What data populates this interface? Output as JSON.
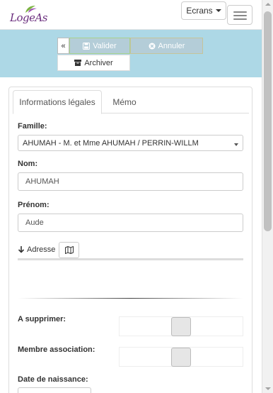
{
  "navbar": {
    "logo_text": "LogeAs",
    "ecrans_label": "Ecrans"
  },
  "toolbar": {
    "collapse_label": "«",
    "valider_label": "Valider",
    "annuler_label": "Annuler",
    "archiver_label": "Archiver"
  },
  "tabs": [
    {
      "label": "Informations légales",
      "active": true
    },
    {
      "label": "Mémo",
      "active": false
    }
  ],
  "form": {
    "famille_label": "Famille:",
    "famille_value": "AHUMAH - M. et Mme AHUMAH / PERRIN-WILLM",
    "nom_label": "Nom:",
    "nom_value": "AHUMAH",
    "prenom_label": "Prénom:",
    "prenom_value": "Aude",
    "adresse_label": "Adresse",
    "supprimer_label": "A supprimer:",
    "membre_label": "Membre association:",
    "naissance_label": "Date de naissance:"
  },
  "colors": {
    "toolbar_bg": "#add8e6",
    "logo": "#6a2d7d"
  },
  "icons": [
    "save-icon",
    "cancel-icon",
    "archive-icon",
    "arrow-down-icon",
    "map-icon",
    "hamburger-icon"
  ]
}
